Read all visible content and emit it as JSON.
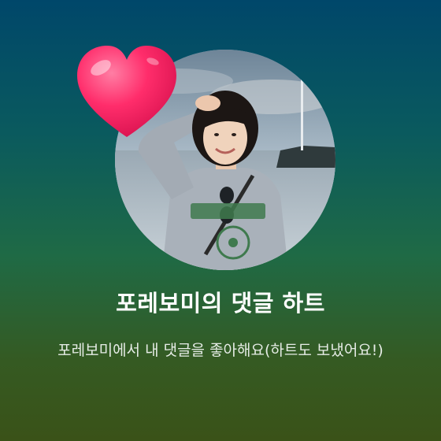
{
  "notification": {
    "title": "포레보미의 댓글 하트",
    "message": "포레보미에서 내 댓글을 좋아해요(하트도 보냈어요!)"
  },
  "icons": {
    "reaction": "heart-icon"
  },
  "colors": {
    "heart": "#ff2d6b",
    "title_text": "#ffffff",
    "message_text": "#e6ece6"
  }
}
